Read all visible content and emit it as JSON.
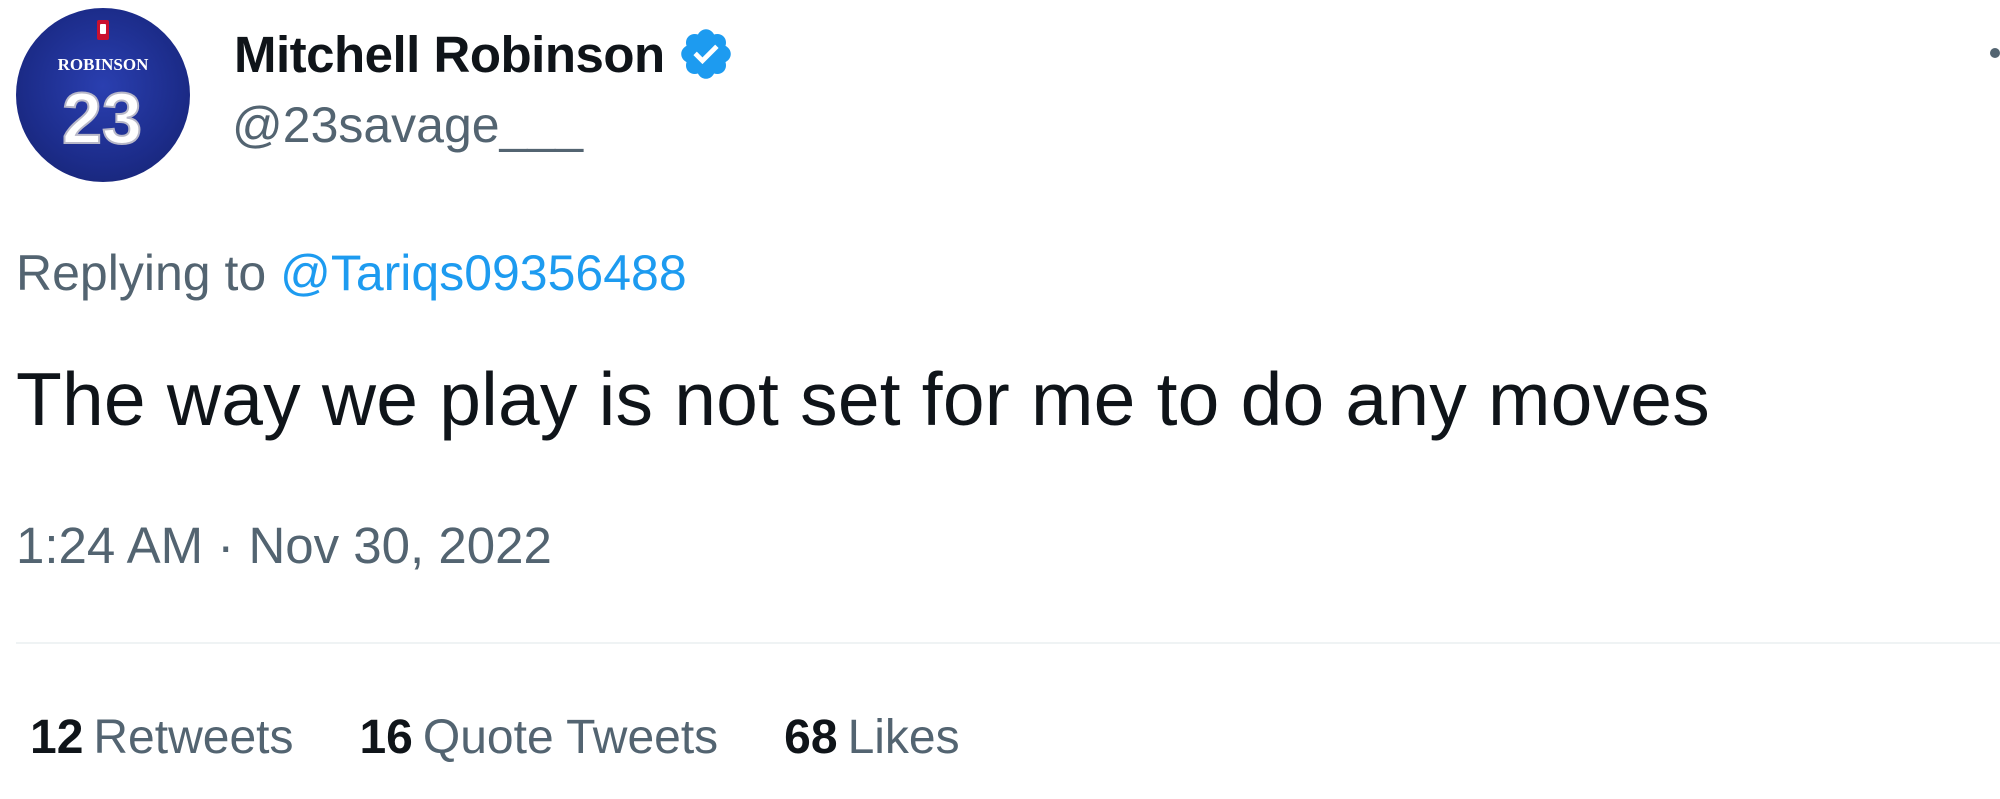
{
  "author": {
    "display_name": "Mitchell Robinson",
    "handle": "@23savage___",
    "avatar": {
      "jersey_name": "ROBINSON",
      "jersey_number": "23"
    },
    "verified": true,
    "verified_color": "#1d9bf0"
  },
  "reply": {
    "prefix": "Replying to",
    "mention": "@Tariqs09356488"
  },
  "tweet": {
    "text": "The way we play is not set for me to do any moves",
    "timestamp": "1:24 AM · Nov 30, 2022"
  },
  "stats": [
    {
      "count": "12",
      "label": "Retweets"
    },
    {
      "count": "16",
      "label": "Quote Tweets"
    },
    {
      "count": "68",
      "label": "Likes"
    }
  ],
  "icons": {
    "verified": "verified-badge-icon",
    "more": "more-options-icon"
  },
  "colors": {
    "text_primary": "#0f1419",
    "text_secondary": "#536471",
    "link": "#1d9bf0"
  }
}
